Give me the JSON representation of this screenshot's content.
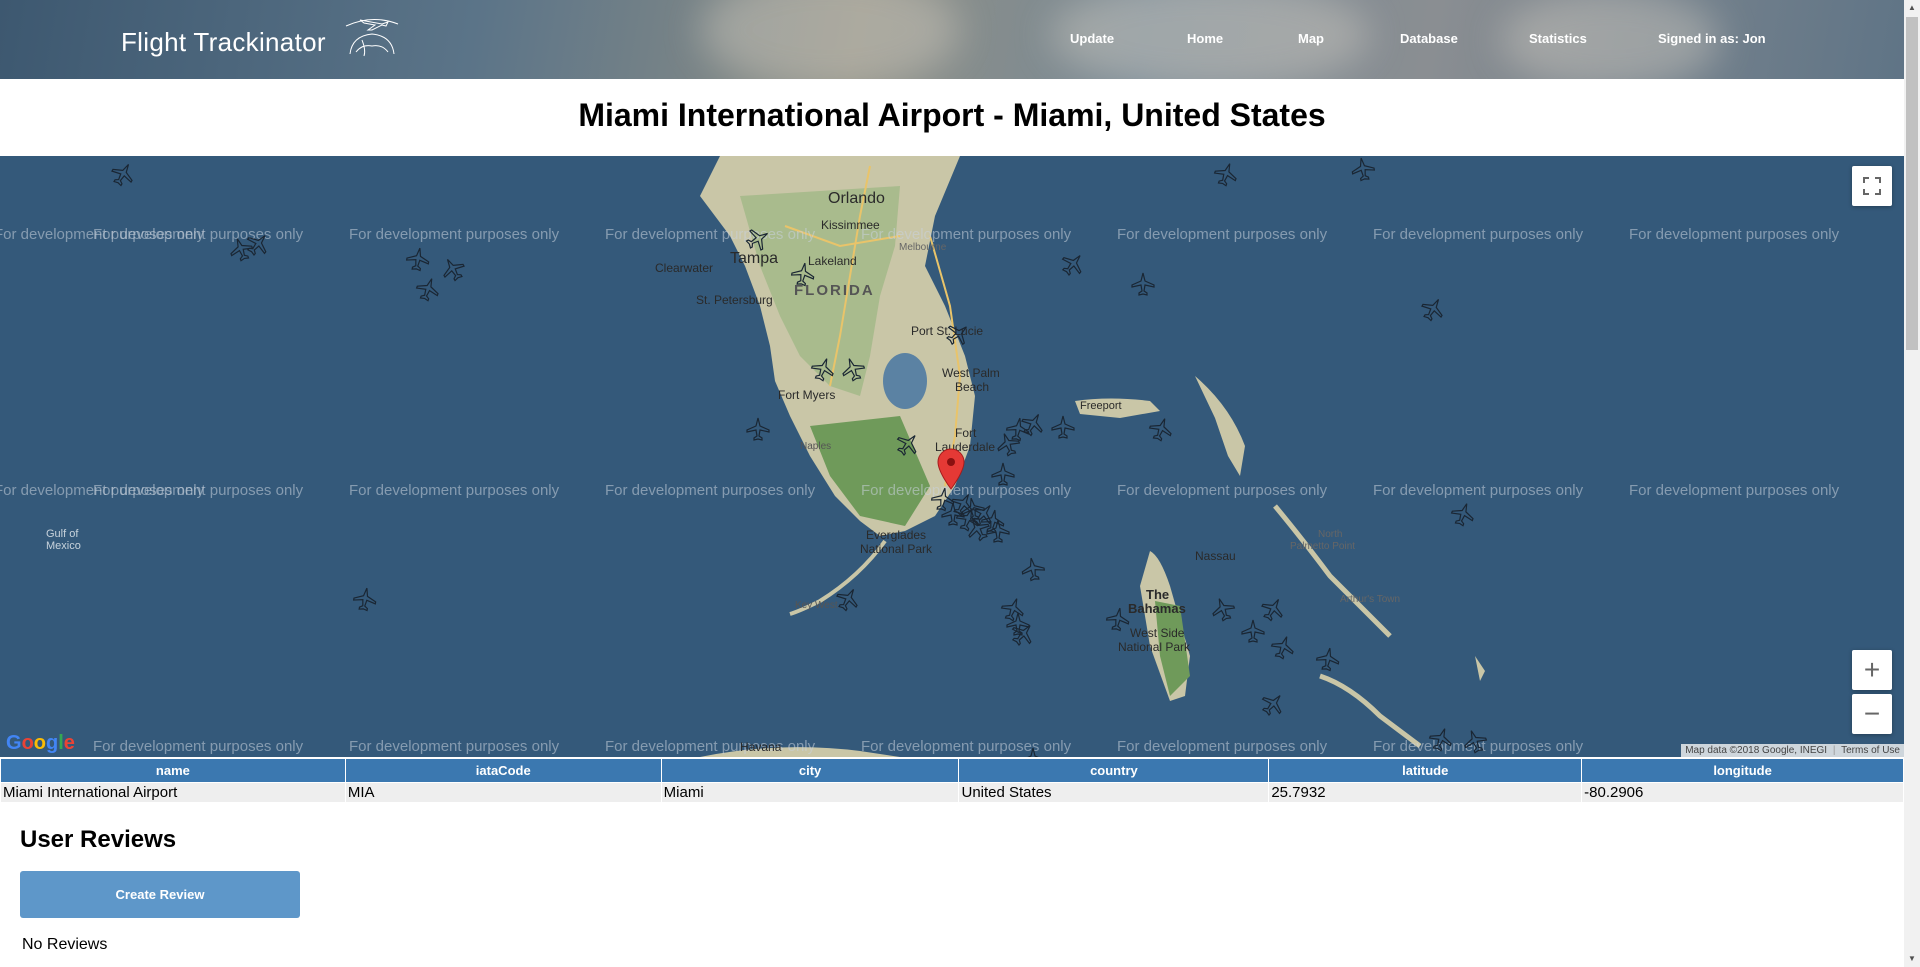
{
  "header": {
    "brand": "Flight Trackinator",
    "nav": [
      {
        "label": "Update"
      },
      {
        "label": "Home"
      },
      {
        "label": "Map"
      },
      {
        "label": "Database"
      },
      {
        "label": "Statistics"
      },
      {
        "label": "Signed in as: Jon"
      }
    ]
  },
  "page": {
    "title": "Miami International Airport - Miami, United States"
  },
  "map": {
    "watermark": "For development purposes only",
    "labels": {
      "orlando": "Orlando",
      "kissimmee": "Kissimmee",
      "tampa": "Tampa",
      "lakeland": "Lakeland",
      "clearwater": "Clearwater",
      "st_petersburg": "St. Petersburg",
      "florida": "FLORIDA",
      "melbourne": "Melbourne",
      "port_st_lucie": "Port St. Lucie",
      "west_palm_beach_1": "West Palm",
      "west_palm_beach_2": "Beach",
      "fort_myers": "Fort Myers",
      "naples": "Naples",
      "fort_lauderdale_1": "Fort",
      "fort_lauderdale_2": "Lauderdale",
      "everglades_1": "Everglades",
      "everglades_2": "National Park",
      "key_west": "Key West",
      "gulf_1": "Gulf of",
      "gulf_2": "Mexico",
      "freeport": "Freeport",
      "nassau": "Nassau",
      "bahamas_1": "The",
      "bahamas_2": "Bahamas",
      "west_side_1": "West Side",
      "west_side_2": "National Park",
      "north_palmetto_1": "North",
      "north_palmetto_2": "Palmetto Point",
      "arthurs_town": "Arthur's Town",
      "havana": "Havana"
    },
    "attribution": "Map data ©2018 Google, INEGI",
    "terms": "Terms of Use",
    "zoom_in": "+",
    "zoom_out": "−",
    "google": "Google",
    "icons": {
      "fullscreen": "fullscreen-icon",
      "marker": "map-pin-icon",
      "plane": "airplane-icon"
    }
  },
  "table": {
    "headers": [
      "name",
      "iataCode",
      "city",
      "country",
      "latitude",
      "longitude"
    ],
    "row": [
      "Miami International Airport",
      "MIA",
      "Miami",
      "United States",
      "25.7932",
      "-80.2906"
    ]
  },
  "reviews": {
    "title": "User Reviews",
    "create_label": "Create Review",
    "empty_text": "No Reviews"
  },
  "colors": {
    "ocean": "#34597a",
    "header_blue": "#3b78b0",
    "button_blue": "#5e97c9",
    "marker_red": "#e53935"
  }
}
